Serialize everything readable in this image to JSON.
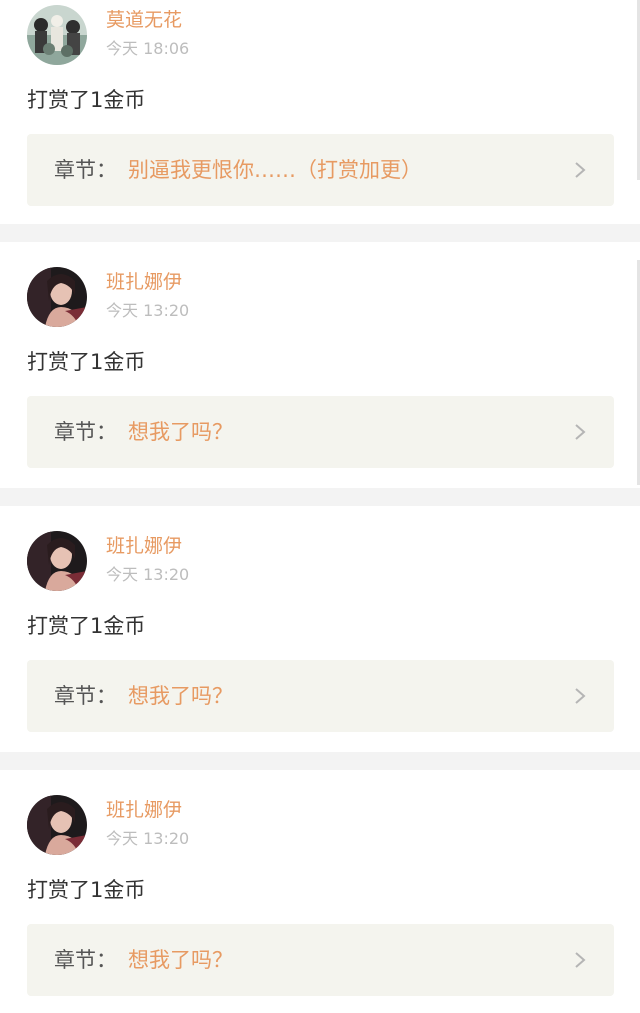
{
  "colors": {
    "accent": "#e79a62",
    "timestamp": "#bdbdbd",
    "body_text": "#333333",
    "chapter_bg": "#f4f4ee",
    "separator": "#f3f3f3"
  },
  "rewards": [
    {
      "username": "莫道无花",
      "time": "今天 18:06",
      "action": "打赏了1金币",
      "chapter_label": "章节：",
      "chapter_title": "别逼我更恨你……（打赏加更）",
      "avatar_icon": "group-photo-avatar"
    },
    {
      "username": "班扎娜伊",
      "time": "今天 13:20",
      "action": "打赏了1金币",
      "chapter_label": "章节：",
      "chapter_title": "想我了吗？",
      "avatar_icon": "portrait-avatar"
    },
    {
      "username": "班扎娜伊",
      "time": "今天 13:20",
      "action": "打赏了1金币",
      "chapter_label": "章节：",
      "chapter_title": "想我了吗？",
      "avatar_icon": "portrait-avatar"
    },
    {
      "username": "班扎娜伊",
      "time": "今天 13:20",
      "action": "打赏了1金币",
      "chapter_label": "章节：",
      "chapter_title": "想我了吗？",
      "avatar_icon": "portrait-avatar"
    }
  ]
}
